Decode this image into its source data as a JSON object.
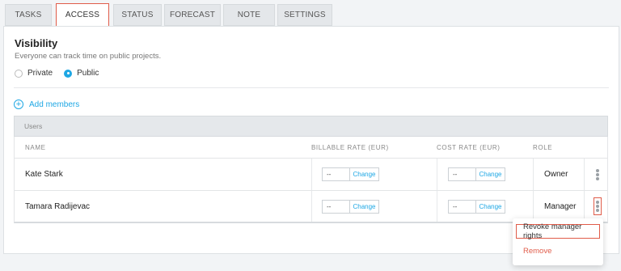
{
  "tabs": [
    {
      "label": "TASKS",
      "active": false
    },
    {
      "label": "ACCESS",
      "active": true
    },
    {
      "label": "STATUS",
      "active": false
    },
    {
      "label": "FORECAST",
      "active": false
    },
    {
      "label": "NOTE",
      "active": false
    },
    {
      "label": "SETTINGS",
      "active": false
    }
  ],
  "visibility": {
    "title": "Visibility",
    "description": "Everyone can track time on public projects.",
    "options": [
      {
        "label": "Private",
        "selected": false
      },
      {
        "label": "Public",
        "selected": true
      }
    ]
  },
  "add_members": {
    "label": "Add members",
    "icon": "plus-circle-icon"
  },
  "table": {
    "group_label": "Users",
    "columns": {
      "name": "NAME",
      "billable_rate": "BILLABLE RATE (EUR)",
      "cost_rate": "COST RATE (EUR)",
      "role": "ROLE"
    },
    "rows": [
      {
        "name": "Kate Stark",
        "billable_value": "--",
        "billable_change": "Change",
        "cost_value": "--",
        "cost_change": "Change",
        "role": "Owner"
      },
      {
        "name": "Tamara Radijevac",
        "billable_value": "--",
        "billable_change": "Change",
        "cost_value": "--",
        "cost_change": "Change",
        "role": "Manager"
      }
    ]
  },
  "context_menu": {
    "items": [
      {
        "label": "Revoke manager rights",
        "highlighted": true
      },
      {
        "label": "Remove",
        "danger": true
      }
    ]
  },
  "colors": {
    "accent": "#1ea7e4",
    "danger": "#e05c4a",
    "highlight_border": "#e05c4a"
  }
}
